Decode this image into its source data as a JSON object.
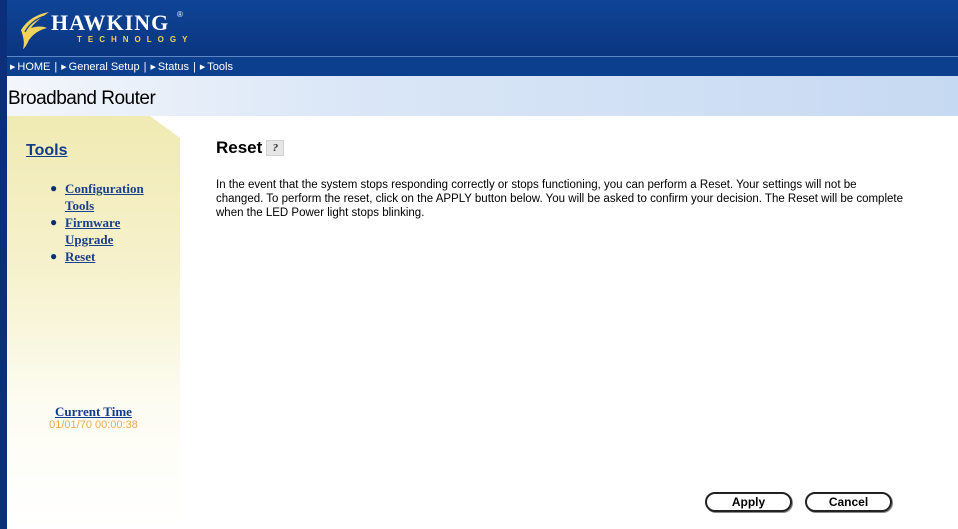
{
  "header": {
    "logo_text": "HAWKING",
    "logo_sub": "TECHNOLOGY",
    "logo_reg": "®"
  },
  "nav": {
    "items": [
      "HOME",
      "General Setup",
      "Status",
      "Tools"
    ],
    "separator": "|"
  },
  "product": {
    "title": "Broadband Router"
  },
  "sidebar": {
    "title": "Tools",
    "items": [
      "Configuration Tools",
      "Firmware Upgrade",
      "Reset"
    ],
    "current_time_label": "Current Time",
    "current_time_value": "01/01/70 00:00:38"
  },
  "content": {
    "title": "Reset",
    "help_glyph": "?",
    "description": "In the event that the system stops responding correctly or stops functioning, you can perform a Reset. Your settings will not be changed. To perform the reset, click on the APPLY button below. You will be asked to confirm your decision. The Reset will be complete when the LED Power light stops blinking."
  },
  "buttons": {
    "apply": "Apply",
    "cancel": "Cancel"
  },
  "colors": {
    "header_blue": "#0d3f8f",
    "accent_yellow": "#f2d35a",
    "time_orange": "#f0a94c",
    "link_blue": "#1a3f8f"
  }
}
